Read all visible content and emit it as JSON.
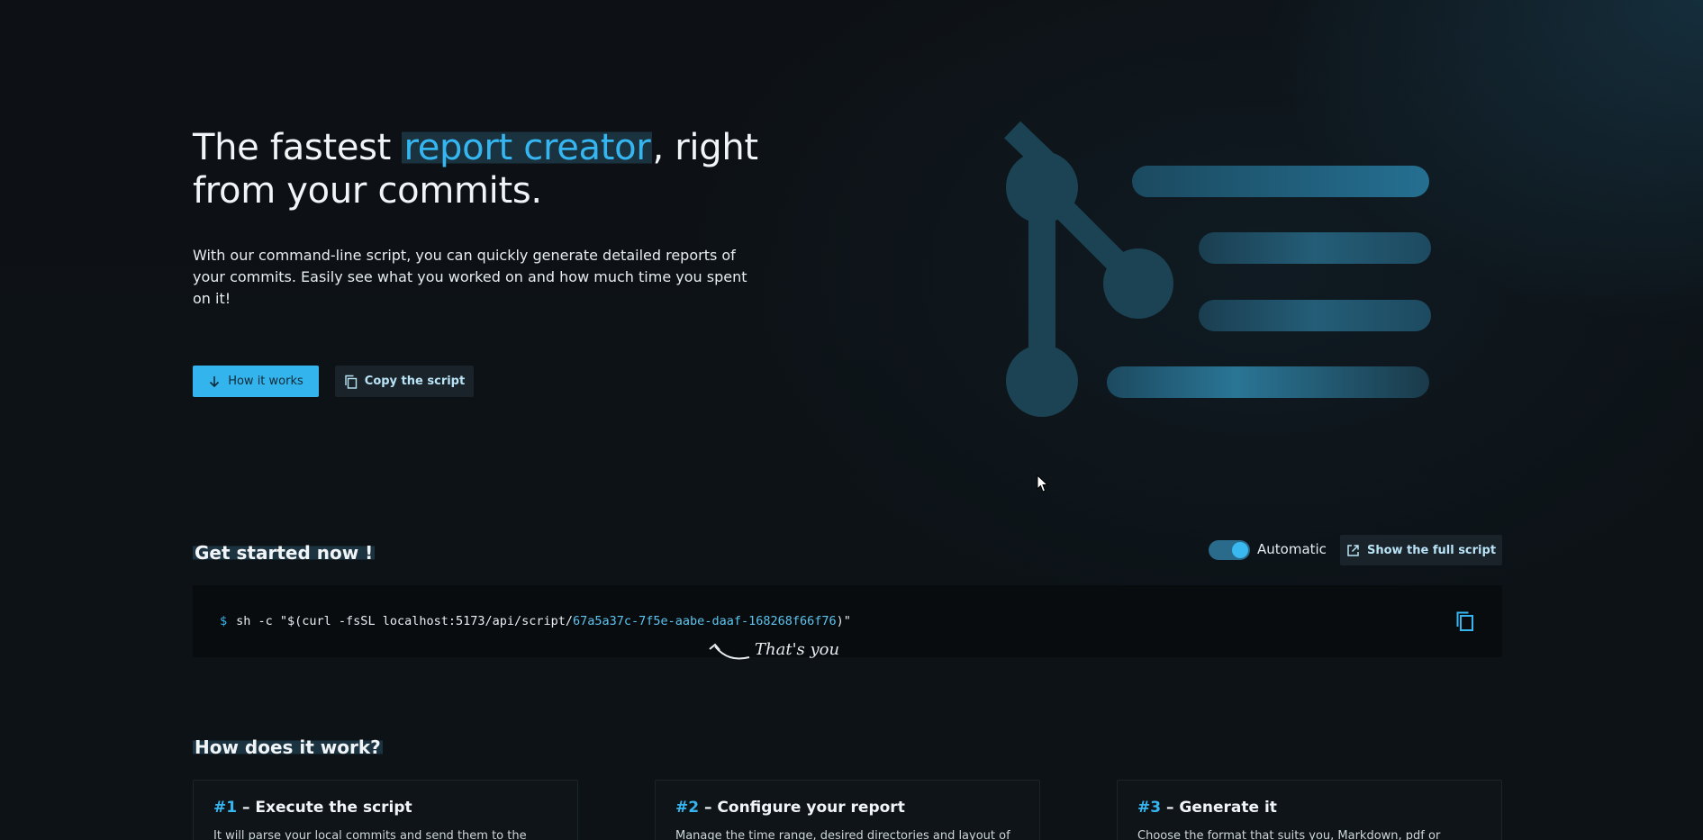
{
  "hero": {
    "title_before": "The fastest ",
    "title_highlight": "report creator",
    "title_after": ", right from your commits.",
    "description": "With our command-line script, you can quickly generate detailed reports of your commits. Easily see what you worked on and how much time you spent on it!",
    "how_it_works_label": "How it works",
    "copy_script_label": "Copy the script"
  },
  "get_started": {
    "title": "Get started now !",
    "toggle_label": "Automatic",
    "toggle_on": true,
    "show_full_script_label": "Show the full script",
    "prompt": "$",
    "command_prefix": "sh -c \"$(curl -fsSL localhost:5173/api/script/",
    "command_uuid": "67a5a37c-7f5e-aabe-daaf-168268f66f76",
    "command_suffix": ")\"",
    "annotation": "That's you"
  },
  "how": {
    "title": "How does it work?",
    "cards": [
      {
        "num": "#1",
        "title": " – Execute the script",
        "desc": "It will parse your local commits and send them to the"
      },
      {
        "num": "#2",
        "title": " – Configure your report",
        "desc": "Manage the time range, desired directories and layout of"
      },
      {
        "num": "#3",
        "title": " – Generate it",
        "desc": "Choose the format that suits you, Markdown, pdf or"
      }
    ]
  },
  "colors": {
    "accent": "#36b6f0",
    "background": "#0c1014",
    "button_secondary": "#1a2329"
  }
}
